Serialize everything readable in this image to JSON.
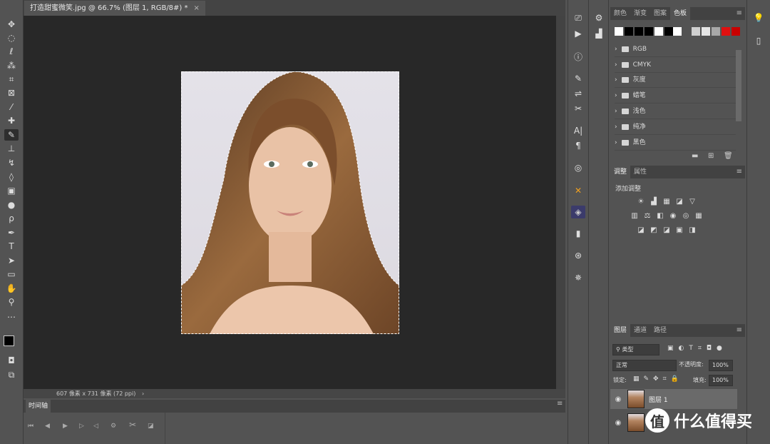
{
  "document": {
    "tab_title": "打造甜蜜微笑.jpg @ 66.7% (图层 1, RGB/8#) *",
    "close_label": "×",
    "status": "607 像素 x 731 像素 (72 ppi)"
  },
  "timeline": {
    "label": "时间轴"
  },
  "swatches_panel": {
    "tabs": [
      "颜色",
      "渐变",
      "图案",
      "色板"
    ],
    "menu_icon": "≡",
    "colors": [
      "#ffffff",
      "#000000",
      "#000000",
      "#000000",
      "#ffffff",
      "#000000",
      "#ffffff",
      "#cfcfcf",
      "#e6e6e6",
      "#a8a8a8",
      "#e01010",
      "#c80000"
    ],
    "groups": [
      "RGB",
      "CMYK",
      "灰度",
      "蜡笔",
      "浅色",
      "纯净",
      "黑色"
    ]
  },
  "adjust_panel": {
    "tabs": [
      "调整",
      "属性"
    ],
    "title": "添加调整",
    "row1": [
      "☀",
      "▟",
      "▦",
      "◪",
      "▽"
    ],
    "row2": [
      "▥",
      "⚖",
      "◧",
      "◉",
      "◎",
      "▦"
    ],
    "row3": [
      "◪",
      "◩",
      "◪",
      "▣",
      "◨"
    ]
  },
  "layers_panel": {
    "tabs": [
      "图层",
      "通道",
      "路径"
    ],
    "filter_label": "类型",
    "blend_mode": "正常",
    "opacity_label": "不透明度:",
    "opacity_value": "100%",
    "lock_label": "锁定:",
    "fill_label": "填充:",
    "fill_value": "100%",
    "layers": [
      {
        "name": "图层 1"
      },
      {
        "name": ""
      }
    ]
  },
  "watermark": {
    "logo": "值",
    "text": "什么值得买"
  },
  "colors": {
    "canvas_bg": "#282828",
    "ui_bg": "#535353",
    "selected_layer": "#6a6a6a"
  }
}
